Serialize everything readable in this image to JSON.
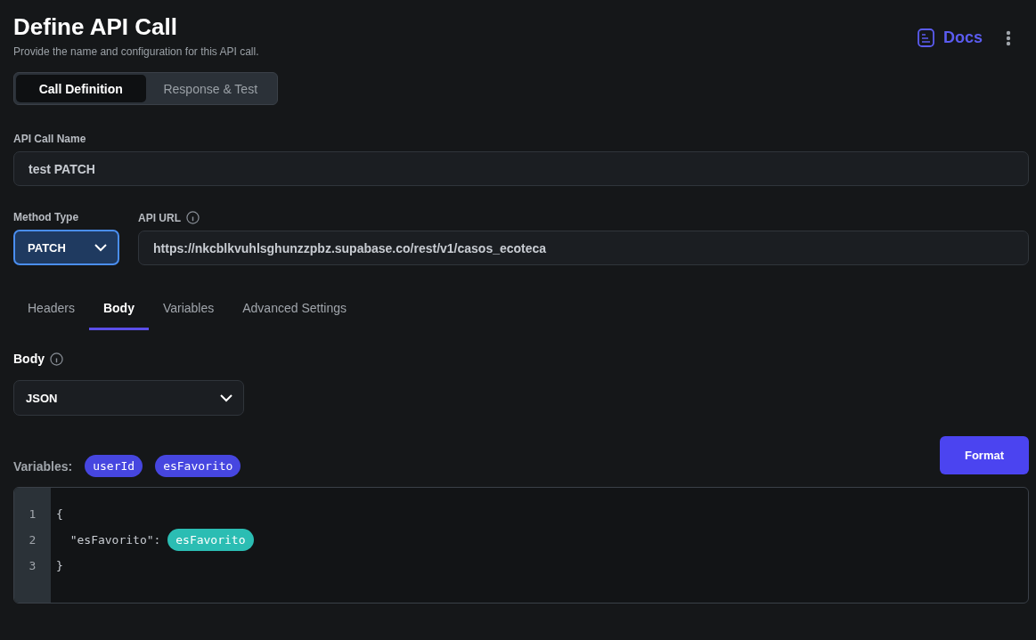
{
  "header": {
    "title": "Define API Call",
    "subtitle": "Provide the name and configuration for this API call.",
    "docs_link": "Docs"
  },
  "mode_tabs": [
    {
      "label": "Call Definition",
      "selected": true
    },
    {
      "label": "Response & Test",
      "selected": false
    }
  ],
  "call_name": {
    "label": "API Call Name",
    "value": "test PATCH"
  },
  "method": {
    "label": "Method Type",
    "value": "PATCH"
  },
  "api_url": {
    "label": "API URL",
    "value": "https://nkcblkvuhlsghunzzpbz.supabase.co/rest/v1/casos_ecoteca"
  },
  "section_tabs": [
    {
      "label": "Headers",
      "selected": false
    },
    {
      "label": "Body",
      "selected": true
    },
    {
      "label": "Variables",
      "selected": false
    },
    {
      "label": "Advanced Settings",
      "selected": false
    }
  ],
  "body": {
    "label": "Body",
    "type": "JSON"
  },
  "variables": {
    "label": "Variables:",
    "items": [
      "userId",
      "esFavorito"
    ]
  },
  "format_button": "Format",
  "editor": {
    "lines": [
      {
        "number": "1",
        "segments": [
          {
            "kind": "text",
            "text": "{"
          }
        ]
      },
      {
        "number": "2",
        "segments": [
          {
            "kind": "text",
            "text": "  \"esFavorito\": "
          },
          {
            "kind": "variable",
            "text": "esFavorito"
          }
        ]
      },
      {
        "number": "3",
        "segments": [
          {
            "kind": "text",
            "text": "}"
          }
        ]
      }
    ]
  }
}
